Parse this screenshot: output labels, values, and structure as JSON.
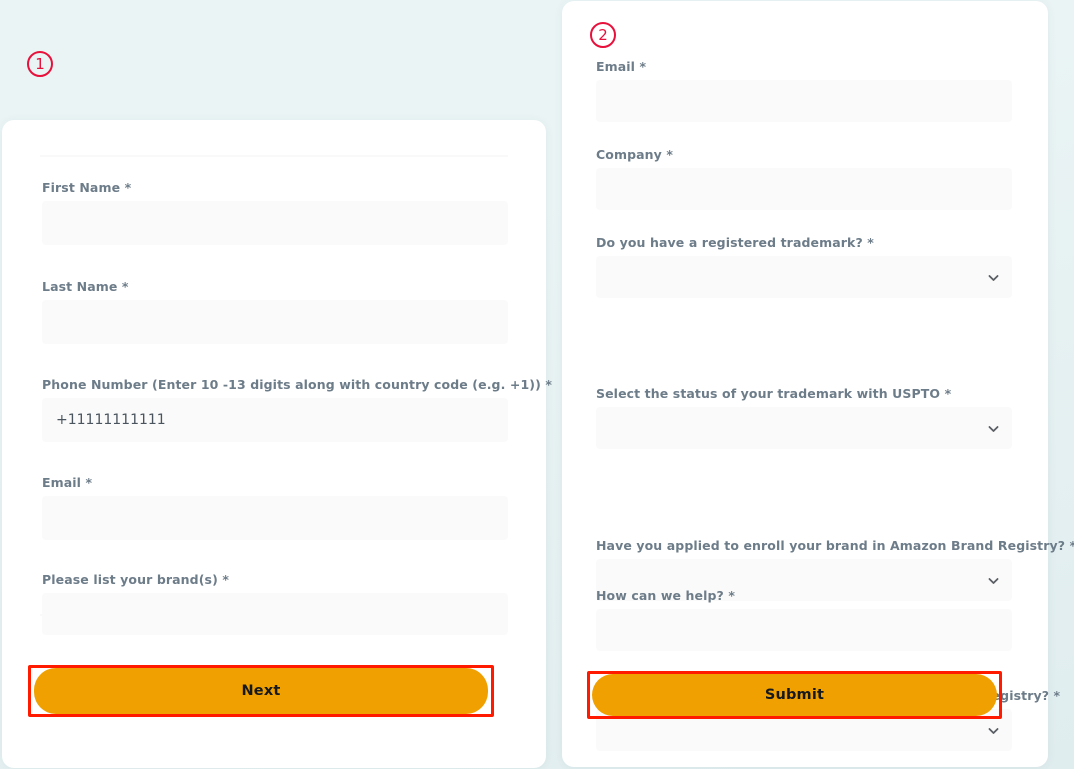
{
  "annotations": {
    "step1": "①",
    "step2": "②"
  },
  "colors": {
    "accent_orange": "#f0a000",
    "highlight_red": "#ff1a00",
    "annotation_red": "#e8113c",
    "label_gray": "#6d7c89",
    "input_bg": "#fafafa",
    "card_bg": "#ffffff",
    "page_bg": "#eaf4f5"
  },
  "step1_form": {
    "fields": [
      {
        "label": "First Name *",
        "value": "",
        "type": "text"
      },
      {
        "label": "Last Name *",
        "value": "",
        "type": "text"
      },
      {
        "label": "Phone Number (Enter 10 -13 digits along with country code (e.g. +1)) *",
        "value": "+11111111111",
        "type": "text"
      },
      {
        "label": "Email *",
        "value": "",
        "type": "text"
      },
      {
        "label": "Please list your brand(s) *",
        "value": "",
        "type": "text"
      }
    ],
    "submit_label": "Next"
  },
  "step2_form": {
    "fields": [
      {
        "label": "Email *",
        "value": "",
        "type": "text"
      },
      {
        "label": "Company *",
        "value": "",
        "type": "text"
      },
      {
        "label": "Do you have a registered trademark? *",
        "value": "",
        "type": "select"
      },
      {
        "label": "Select the status of your trademark with USPTO *",
        "value": "",
        "type": "select"
      },
      {
        "label": "Have you applied to enroll your brand in Amazon Brand Registry? *",
        "value": "",
        "type": "select"
      },
      {
        "label": "Has your brand or account been removed from Brand Registry? *",
        "value": "",
        "type": "select"
      },
      {
        "label": "How can we help? *",
        "value": "",
        "type": "text"
      }
    ],
    "submit_label": "Submit"
  },
  "icons": {
    "chevron": "chevron-down-icon"
  }
}
